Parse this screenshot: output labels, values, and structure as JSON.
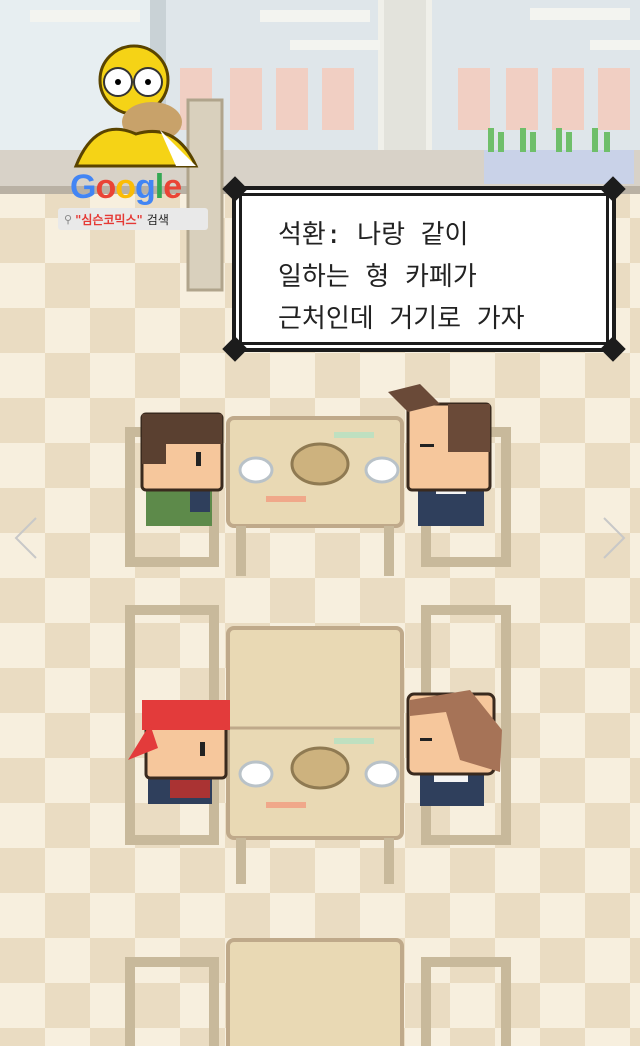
{
  "dialog": {
    "lines": [
      "석환: 나랑 같이",
      "일하는 형 카페가",
      "근처인데 거기로 가자"
    ]
  },
  "overlay": {
    "brand_letters": [
      "G",
      "o",
      "o",
      "g",
      "l",
      "e"
    ],
    "search_query": "\"심슨코믹스\"",
    "search_suffix": "검색"
  },
  "navigation": {
    "prev_icon": "chevron-left-icon",
    "next_icon": "chevron-right-icon"
  },
  "colors": {
    "floor_light": "#f7efde",
    "floor_dark": "#eadcc2",
    "table": "#e9d9b4",
    "table_edge": "#bfa98a",
    "dialog_border": "#1c1c1c"
  }
}
